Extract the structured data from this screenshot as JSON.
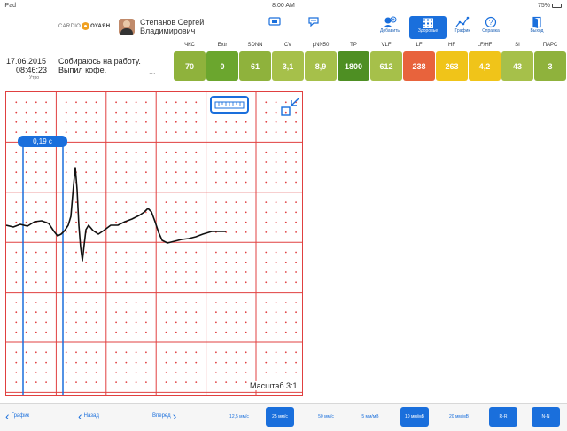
{
  "status_bar": {
    "carrier": "iPad",
    "time": "8:00 AM",
    "battery": "75%"
  },
  "logo": {
    "left": "CARDIO",
    "right": "ОУАЯН"
  },
  "user": {
    "first_line": "Степанов Сергей",
    "second_line": "Владимирович"
  },
  "toolbar": {
    "add_label": "Добавить",
    "health_label": "Здоровье",
    "graph_label": "График",
    "help_label": "Справка",
    "exit_label": "Выход"
  },
  "metrics": [
    {
      "label": "ЧКС",
      "value": "70",
      "color": "#8fb23c"
    },
    {
      "label": "Extr",
      "value": "0",
      "color": "#6ba62e"
    },
    {
      "label": "SDNN",
      "value": "61",
      "color": "#8fb23c"
    },
    {
      "label": "CV",
      "value": "3,1",
      "color": "#a6c04a"
    },
    {
      "label": "pNN50",
      "value": "8,9",
      "color": "#a6c04a"
    },
    {
      "label": "TP",
      "value": "1800",
      "color": "#4e8f23"
    },
    {
      "label": "VLF",
      "value": "612",
      "color": "#a6c04a"
    },
    {
      "label": "LF",
      "value": "238",
      "color": "#e8633c"
    },
    {
      "label": "HF",
      "value": "263",
      "color": "#f0c419"
    },
    {
      "label": "LF/HF",
      "value": "4,2",
      "color": "#f0c419"
    },
    {
      "label": "SI",
      "value": "43",
      "color": "#a6c04a"
    },
    {
      "label": "ПАРС",
      "value": "3",
      "color": "#8fb23c"
    }
  ],
  "entry": {
    "date": "17.06.2015",
    "time": "08:46:23",
    "period": "Утро",
    "note_line1": "Собираюсь на работу.",
    "note_line2": "Выпил кофе.",
    "more": "..."
  },
  "ecg": {
    "interval_label": "0,19 с",
    "scale_label": "Масштаб 3:1"
  },
  "bottom": {
    "graph_label": "График",
    "back_label": "Назад",
    "forward_label": "Вперед",
    "speeds": [
      {
        "label": "12,5 мм/с",
        "active": false
      },
      {
        "label": "25 мм/с",
        "active": true
      },
      {
        "label": "50 мм/с",
        "active": false
      },
      {
        "label": "5 мм/мВ",
        "active": false
      },
      {
        "label": "10 мм/мВ",
        "active": true
      },
      {
        "label": "20 мм/мВ",
        "active": false
      },
      {
        "label": "R-R",
        "active": true
      },
      {
        "label": "N-N",
        "active": true
      }
    ]
  },
  "colors": {
    "accent": "#1a6fdc",
    "grid": "#e04040",
    "trace": "#111111"
  }
}
